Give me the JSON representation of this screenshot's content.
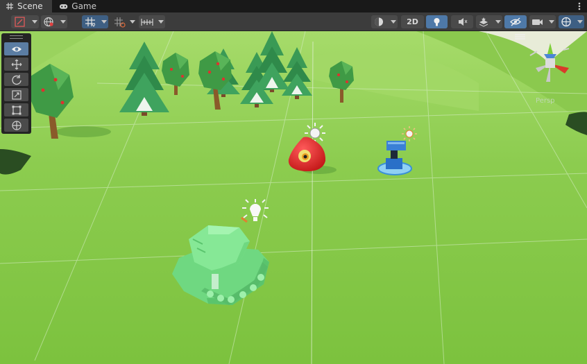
{
  "tabs": [
    {
      "label": "Scene",
      "icon": "grid-icon",
      "active": true
    },
    {
      "label": "Game",
      "icon": "gamepad-icon",
      "active": false
    }
  ],
  "toolbar": {
    "left": [
      {
        "name": "draw-mode-dropdown",
        "icon": "draw-mode-icon"
      },
      {
        "name": "global-dropdown",
        "icon": "globe-icon"
      },
      {
        "name": "grid-snap-toggle",
        "icon": "grid-snap-icon",
        "on": true
      },
      {
        "name": "increment-snap-dropdown",
        "icon": "increment-snap-icon"
      },
      {
        "name": "snap-settings-dropdown",
        "icon": "ruler-icon"
      }
    ],
    "right": [
      {
        "name": "shading-mode-dropdown",
        "icon": "shading-sphere-icon"
      },
      {
        "name": "2d-toggle",
        "label": "2D"
      },
      {
        "name": "lighting-toggle",
        "icon": "lightbulb-icon",
        "on": true
      },
      {
        "name": "audio-toggle",
        "icon": "audio-icon"
      },
      {
        "name": "effects-dropdown",
        "icon": "effects-icon"
      },
      {
        "name": "hidden-objects-toggle",
        "icon": "eye-slash-icon",
        "on": true
      },
      {
        "name": "camera-dropdown",
        "icon": "camera-icon"
      },
      {
        "name": "gizmos-dropdown",
        "icon": "gizmo-globe-icon",
        "on": true
      }
    ]
  },
  "tools": [
    {
      "name": "view-tool",
      "icon": "eye-icon",
      "active": true
    },
    {
      "name": "move-tool",
      "icon": "move-arrows-icon",
      "active": false
    },
    {
      "name": "rotate-tool",
      "icon": "rotate-icon",
      "active": false
    },
    {
      "name": "scale-tool",
      "icon": "scale-icon",
      "active": false
    },
    {
      "name": "rect-tool",
      "icon": "rect-icon",
      "active": false
    },
    {
      "name": "transform-tool",
      "icon": "transform-icon",
      "active": false
    }
  ],
  "viewport": {
    "projection_label": "Persp",
    "colors": {
      "grass": "#8fcf52",
      "tank": "#7fe58f",
      "enemy": "#e02d2d",
      "turret": "#3a80d6"
    },
    "objects": [
      "tank",
      "red-blob-enemy",
      "turret",
      "pine-trees",
      "apple-trees",
      "light-gizmos"
    ]
  }
}
